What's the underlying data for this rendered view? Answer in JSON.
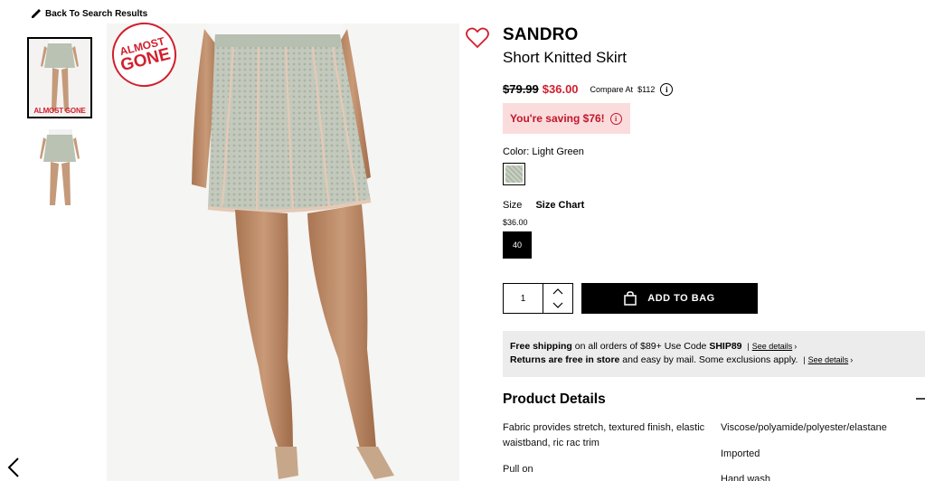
{
  "back_link": "Back To Search Results",
  "badge": {
    "line1": "ALMOST",
    "line2": "GONE",
    "thumb_text": "ALMOST GONE"
  },
  "product": {
    "brand": "SANDRO",
    "name": "Short Knitted Skirt",
    "old_price": "$79.99",
    "price": "$36.00",
    "compare_label": "Compare At",
    "compare_value": "$112",
    "saving_text": "You're saving $76!"
  },
  "color": {
    "label": "Color:",
    "value": "Light Green"
  },
  "size": {
    "label": "Size",
    "chart_label": "Size Chart",
    "price": "$36.00",
    "selected": "40"
  },
  "quantity": {
    "value": "1"
  },
  "add_to_bag": "ADD TO BAG",
  "shipping": {
    "line1_bold": "Free shipping",
    "line1_rest": " on all orders of $89+ Use Code ",
    "line1_code": "SHIP89",
    "line1_link": "See details",
    "line2_bold": "Returns are free in store",
    "line2_rest": " and easy by mail. Some exclusions apply.",
    "line2_link": "See details",
    "separator": "|",
    "chevron": "›"
  },
  "details": {
    "heading": "Product Details",
    "left": [
      "Fabric provides stretch, textured finish, elastic waistband, ric rac trim",
      "Pull on"
    ],
    "right": [
      "Viscose/polyamide/polyester/elastane",
      "Imported",
      "Hand wash"
    ]
  },
  "icons": {
    "back": "pencil-icon",
    "wishlist": "heart-icon",
    "info": "info-icon",
    "bag": "shopping-bag-icon",
    "prev": "chevron-left-icon",
    "collapse": "minus-icon"
  },
  "colors": {
    "accent_red": "#d11f2e",
    "saving_bg": "#fbdcdc",
    "shipping_bg": "#ececec"
  }
}
